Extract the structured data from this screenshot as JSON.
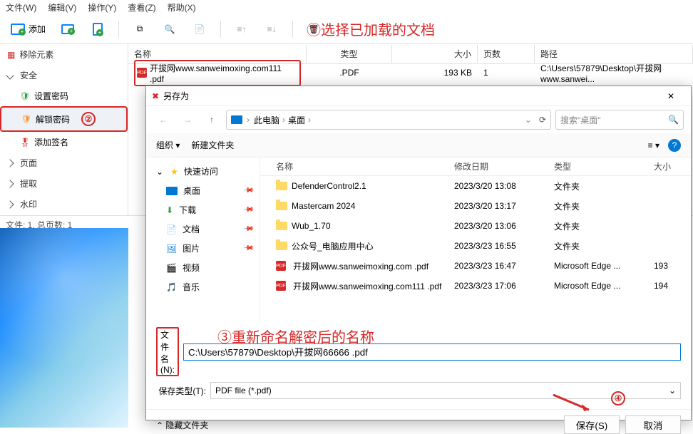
{
  "menubar": {
    "file": "文件(W)",
    "edit": "编辑(V)",
    "action": "操作(Y)",
    "view": "查看(Z)",
    "help": "帮助(X)"
  },
  "toolbar": {
    "add": "添加"
  },
  "annotations": {
    "one": "①选择已加载的文档",
    "two": "②",
    "three": "③重新命名解密后的名称",
    "four": "④"
  },
  "sidebar": {
    "move_elem": "移除元素",
    "security": "安全",
    "set_pwd": "设置密码",
    "unlock_pwd": "解锁密码",
    "add_sig": "添加签名",
    "page": "页面",
    "extract": "提取",
    "watermark": "水印"
  },
  "columns": {
    "name": "名称",
    "type": "类型",
    "size": "大小",
    "pages": "页数",
    "path": "路径"
  },
  "filerow": {
    "name": "开拔网www.sanweimoxing.com111 .pdf",
    "type": ".PDF",
    "size": "193 KB",
    "pages": "1",
    "path": "C:\\Users\\57879\\Desktop\\开拔网www.sanwei..."
  },
  "status": "文件: 1, 总页数: 1",
  "dialog": {
    "title": "另存为",
    "bc1": "此电脑",
    "bc2": "桌面",
    "search_placeholder": "搜索\"桌面\"",
    "organize": "组织",
    "new_folder": "新建文件夹",
    "quick": "快速访问",
    "desktop": "桌面",
    "downloads": "下载",
    "documents": "文档",
    "pictures": "图片",
    "videos": "视频",
    "music": "音乐",
    "cols": {
      "name": "名称",
      "date": "修改日期",
      "type": "类型",
      "size": "大小"
    },
    "rows": [
      {
        "name": "DefenderControl2.1",
        "date": "2023/3/20 13:08",
        "type": "文件夹",
        "size": "",
        "isFolder": true
      },
      {
        "name": "Mastercam 2024",
        "date": "2023/3/20 13:17",
        "type": "文件夹",
        "size": "",
        "isFolder": true
      },
      {
        "name": "Wub_1.70",
        "date": "2023/3/20 13:06",
        "type": "文件夹",
        "size": "",
        "isFolder": true
      },
      {
        "name": "公众号_电脑应用中心",
        "date": "2023/3/23 16:55",
        "type": "文件夹",
        "size": "",
        "isFolder": true
      },
      {
        "name": "开拔网www.sanweimoxing.com .pdf",
        "date": "2023/3/23 16:47",
        "type": "Microsoft Edge ...",
        "size": "193",
        "isFolder": false
      },
      {
        "name": "开拔网www.sanweimoxing.com111 .pdf",
        "date": "2023/3/23 17:06",
        "type": "Microsoft Edge ...",
        "size": "194",
        "isFolder": false
      }
    ],
    "filename_label": "文件名(N):",
    "filename_value": "C:\\Users\\57879\\Desktop\\开拔网66666 .pdf",
    "savetype_label": "保存类型(T):",
    "savetype_value": "PDF file (*.pdf)",
    "hide_folders": "隐藏文件夹",
    "save": "保存(S)",
    "cancel": "取消"
  }
}
